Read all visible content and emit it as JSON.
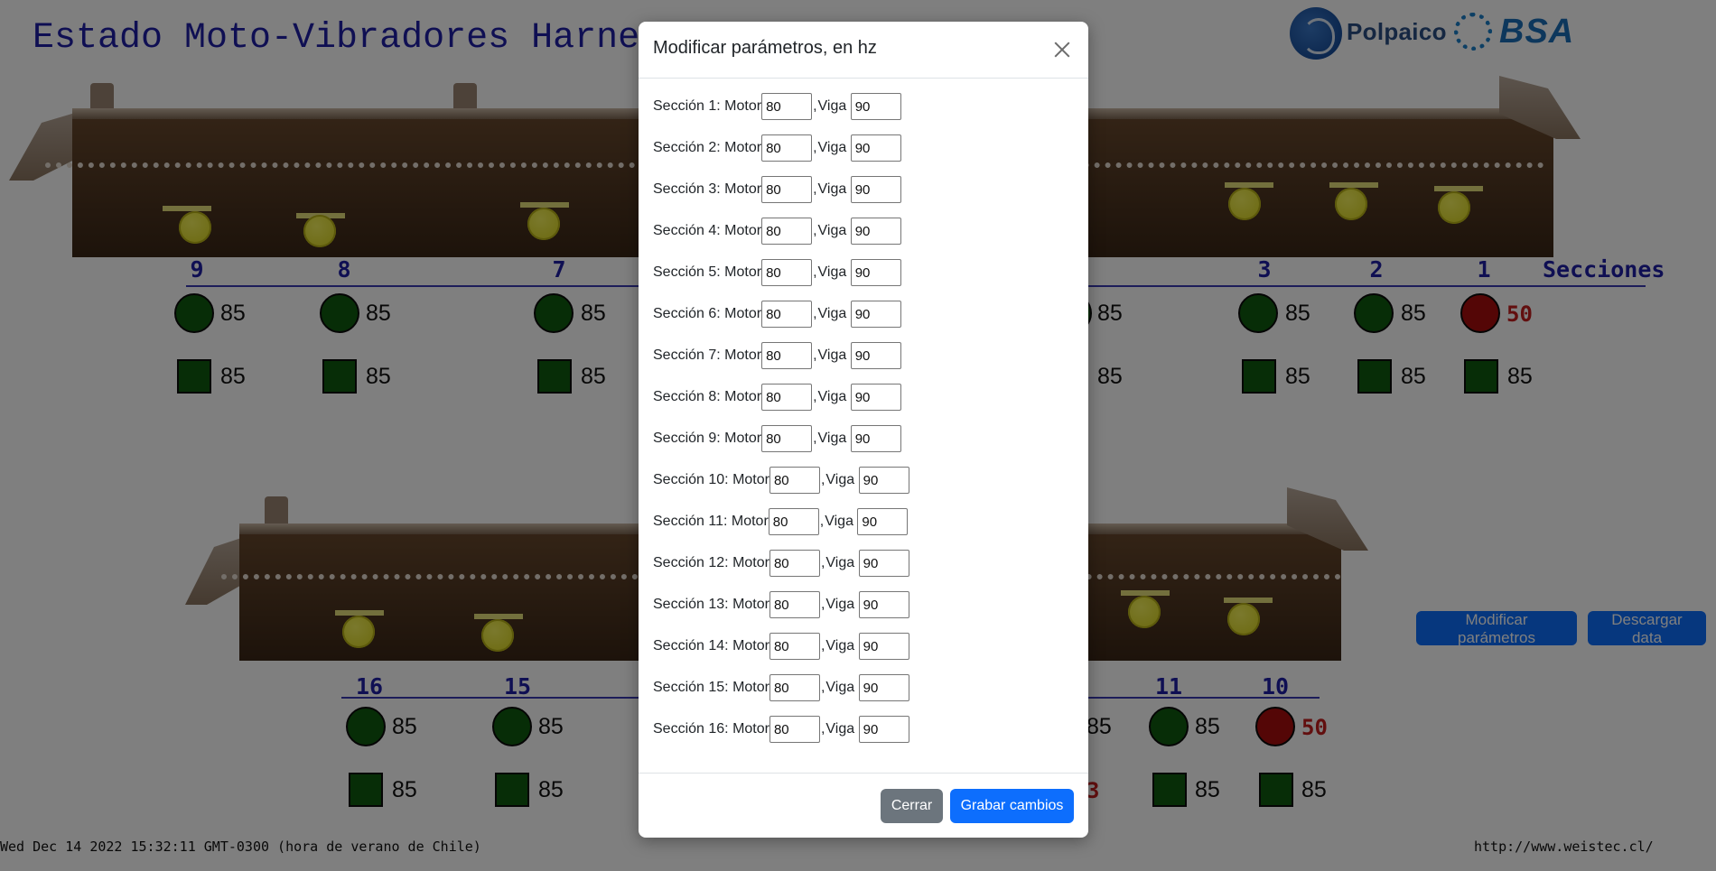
{
  "page": {
    "title": "Estado Moto-Vibradores Harnero",
    "logos": {
      "polpaico": "Polpaico",
      "bsa": "BSA"
    },
    "sections_label": "Secciones",
    "footer_date": "Wed Dec 14 2022 15:32:11 GMT-0300 (hora de verano de Chile)",
    "footer_url": "http://www.weistec.cl/",
    "buttons": {
      "modify": "Modificar parámetros",
      "download": "Descargar data"
    },
    "colors": {
      "ok": "#0f5a0f",
      "alarm": "#a80d0d",
      "title": "#1e1ea6",
      "primary": "#0d6efd"
    },
    "top_sections": [
      {
        "number": "9",
        "circle": {
          "value": "85",
          "status": "ok"
        },
        "square": {
          "value": "85",
          "status": "ok"
        }
      },
      {
        "number": "8",
        "circle": {
          "value": "85",
          "status": "ok"
        },
        "square": {
          "value": "85",
          "status": "ok"
        }
      },
      {
        "number": "7",
        "circle": {
          "value": "85",
          "status": "ok"
        },
        "square": {
          "value": "85",
          "status": "ok"
        }
      },
      {
        "number": "",
        "circle": {
          "value": "85",
          "status": "ok"
        },
        "square": {
          "value": "85",
          "status": "ok"
        }
      },
      {
        "number": "3",
        "circle": {
          "value": "85",
          "status": "ok"
        },
        "square": {
          "value": "85",
          "status": "ok"
        }
      },
      {
        "number": "2",
        "circle": {
          "value": "85",
          "status": "ok"
        },
        "square": {
          "value": "85",
          "status": "ok"
        }
      },
      {
        "number": "1",
        "circle": {
          "value": "50",
          "status": "alarm"
        },
        "square": {
          "value": "85",
          "status": "ok"
        }
      }
    ],
    "bottom_sections": [
      {
        "number": "16",
        "circle": {
          "value": "85",
          "status": "ok"
        },
        "square": {
          "value": "85",
          "status": "ok"
        }
      },
      {
        "number": "15",
        "circle": {
          "value": "85",
          "status": "ok"
        },
        "square": {
          "value": "85",
          "status": "ok"
        }
      },
      {
        "number": "",
        "circle": {
          "value": "85",
          "status": "ok"
        },
        "square": {
          "value": "3",
          "status": "alarm"
        }
      },
      {
        "number": "11",
        "circle": {
          "value": "85",
          "status": "ok"
        },
        "square": {
          "value": "85",
          "status": "ok"
        }
      },
      {
        "number": "10",
        "circle": {
          "value": "50",
          "status": "alarm"
        },
        "square": {
          "value": "85",
          "status": "ok"
        }
      }
    ]
  },
  "modal": {
    "title": "Modificar parámetros, en hz",
    "close_label": "Cerrar",
    "save_label": "Grabar cambios",
    "motor_word": "Motor",
    "viga_word": "Viga",
    "rows": [
      {
        "label": "Sección 1:",
        "motor": "80",
        "viga": "90"
      },
      {
        "label": "Sección 2:",
        "motor": "80",
        "viga": "90"
      },
      {
        "label": "Sección 3:",
        "motor": "80",
        "viga": "90"
      },
      {
        "label": "Sección 4:",
        "motor": "80",
        "viga": "90"
      },
      {
        "label": "Sección 5:",
        "motor": "80",
        "viga": "90"
      },
      {
        "label": "Sección 6:",
        "motor": "80",
        "viga": "90"
      },
      {
        "label": "Sección 7:",
        "motor": "80",
        "viga": "90"
      },
      {
        "label": "Sección 8:",
        "motor": "80",
        "viga": "90"
      },
      {
        "label": "Sección 9:",
        "motor": "80",
        "viga": "90"
      },
      {
        "label": "Sección 10:",
        "motor": "80",
        "viga": "90"
      },
      {
        "label": "Sección 11:",
        "motor": "80",
        "viga": "90"
      },
      {
        "label": "Sección 12:",
        "motor": "80",
        "viga": "90"
      },
      {
        "label": "Sección 13:",
        "motor": "80",
        "viga": "90"
      },
      {
        "label": "Sección 14:",
        "motor": "80",
        "viga": "90"
      },
      {
        "label": "Sección 15:",
        "motor": "80",
        "viga": "90"
      },
      {
        "label": "Sección 16:",
        "motor": "80",
        "viga": "90"
      }
    ]
  }
}
